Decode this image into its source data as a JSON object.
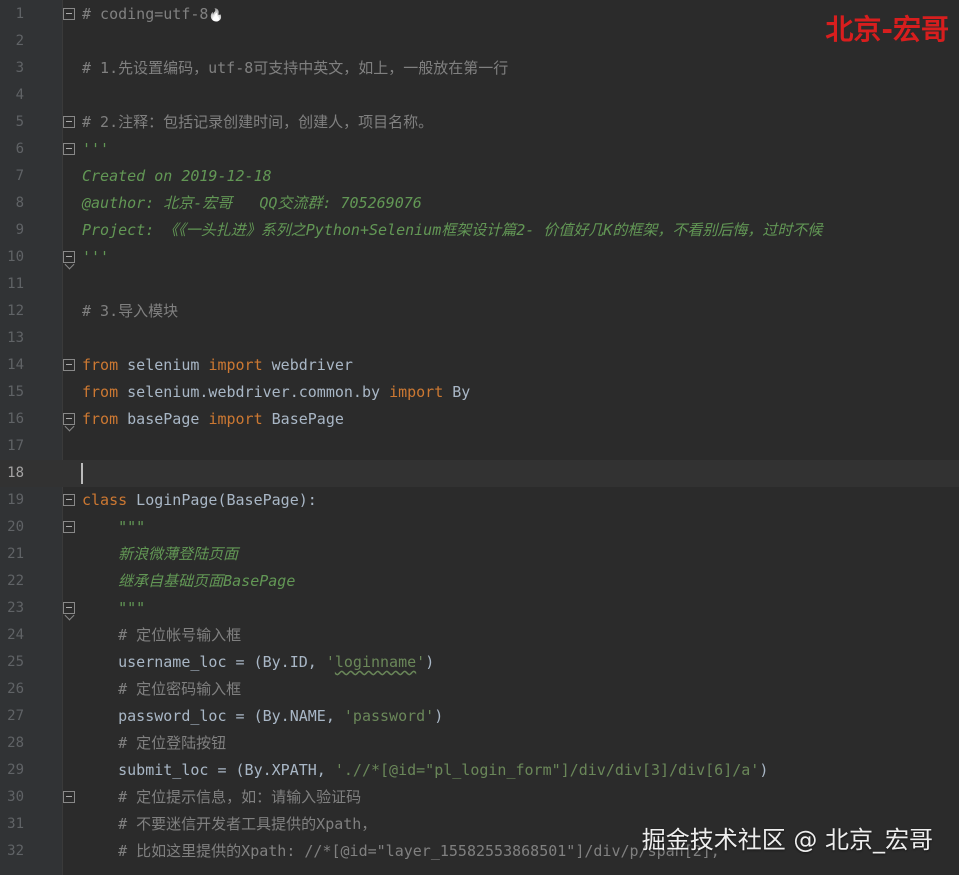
{
  "editor": {
    "lines": [
      {
        "n": "1",
        "tokens": [
          {
            "t": "# coding=utf-8",
            "c": "comment"
          },
          {
            "t": "",
            "c": "fire"
          }
        ],
        "fold": "start"
      },
      {
        "n": "2",
        "tokens": []
      },
      {
        "n": "3",
        "tokens": [
          {
            "t": "# 1.先设置编码，utf-8可支持中英文，如上，一般放在第一行",
            "c": "comment"
          }
        ]
      },
      {
        "n": "4",
        "tokens": []
      },
      {
        "n": "5",
        "tokens": [
          {
            "t": "# 2.注释：包括记录创建时间，创建人，项目名称。",
            "c": "comment"
          }
        ],
        "fold": "start"
      },
      {
        "n": "6",
        "tokens": [
          {
            "t": "'''",
            "c": "doc"
          }
        ],
        "fold": "start"
      },
      {
        "n": "7",
        "tokens": [
          {
            "t": "Created on 2019-12-18",
            "c": "doc"
          }
        ]
      },
      {
        "n": "8",
        "tokens": [
          {
            "t": "@author: 北京-宏哥   QQ交流群: 705269076",
            "c": "doc"
          }
        ]
      },
      {
        "n": "9",
        "tokens": [
          {
            "t": "Project: 《《一头扎进》系列之Python+Selenium框架设计篇2- 价值好几K的框架，不看别后悔，过时不候",
            "c": "doc"
          }
        ]
      },
      {
        "n": "10",
        "tokens": [
          {
            "t": "'''",
            "c": "doc"
          }
        ],
        "fold": "end"
      },
      {
        "n": "11",
        "tokens": []
      },
      {
        "n": "12",
        "tokens": [
          {
            "t": "# 3.导入模块",
            "c": "comment"
          }
        ]
      },
      {
        "n": "13",
        "tokens": []
      },
      {
        "n": "14",
        "tokens": [
          {
            "t": "from",
            "c": "kw"
          },
          {
            "t": " selenium ",
            "c": "plain"
          },
          {
            "t": "import",
            "c": "kw"
          },
          {
            "t": " webdriver",
            "c": "plain"
          }
        ],
        "fold": "start"
      },
      {
        "n": "15",
        "tokens": [
          {
            "t": "from",
            "c": "kw"
          },
          {
            "t": " selenium.webdriver.common.by ",
            "c": "plain"
          },
          {
            "t": "import",
            "c": "kw"
          },
          {
            "t": " By",
            "c": "plain"
          }
        ]
      },
      {
        "n": "16",
        "tokens": [
          {
            "t": "from",
            "c": "kw"
          },
          {
            "t": " basePage ",
            "c": "plain"
          },
          {
            "t": "import",
            "c": "kw"
          },
          {
            "t": " BasePage",
            "c": "plain"
          }
        ],
        "fold": "end"
      },
      {
        "n": "17",
        "tokens": []
      },
      {
        "n": "18",
        "tokens": [],
        "current": true
      },
      {
        "n": "19",
        "tokens": [
          {
            "t": "class",
            "c": "kw"
          },
          {
            "t": " LoginPage(BasePage):",
            "c": "plain"
          }
        ],
        "fold": "start"
      },
      {
        "n": "20",
        "tokens": [
          {
            "t": "    \"\"\"",
            "c": "doc"
          }
        ],
        "fold": "start"
      },
      {
        "n": "21",
        "tokens": [
          {
            "t": "    新浪微薄登陆页面",
            "c": "doc"
          }
        ]
      },
      {
        "n": "22",
        "tokens": [
          {
            "t": "    继承自基础页面BasePage",
            "c": "doc"
          }
        ]
      },
      {
        "n": "23",
        "tokens": [
          {
            "t": "    \"\"\"",
            "c": "doc"
          }
        ],
        "fold": "end"
      },
      {
        "n": "24",
        "tokens": [
          {
            "t": "    # 定位帐号输入框",
            "c": "comment"
          }
        ]
      },
      {
        "n": "25",
        "tokens": [
          {
            "t": "    username_loc = (By.ID, ",
            "c": "plain"
          },
          {
            "t": "'",
            "c": "str"
          },
          {
            "t": "loginname",
            "c": "str squig"
          },
          {
            "t": "'",
            "c": "str"
          },
          {
            "t": ")",
            "c": "plain"
          }
        ]
      },
      {
        "n": "26",
        "tokens": [
          {
            "t": "    # 定位密码输入框",
            "c": "comment"
          }
        ]
      },
      {
        "n": "27",
        "tokens": [
          {
            "t": "    password_loc = (By.NAME, ",
            "c": "plain"
          },
          {
            "t": "'password'",
            "c": "str"
          },
          {
            "t": ")",
            "c": "plain"
          }
        ]
      },
      {
        "n": "28",
        "tokens": [
          {
            "t": "    # 定位登陆按钮",
            "c": "comment"
          }
        ]
      },
      {
        "n": "29",
        "tokens": [
          {
            "t": "    submit_loc = (By.XPATH, ",
            "c": "plain"
          },
          {
            "t": "'.//*[@id=\"pl_login_form\"]/div/div[3]/div[6]/a'",
            "c": "str"
          },
          {
            "t": ")",
            "c": "plain"
          }
        ]
      },
      {
        "n": "30",
        "tokens": [
          {
            "t": "    # 定位提示信息，如：请输入验证码",
            "c": "comment"
          }
        ],
        "fold": "start"
      },
      {
        "n": "31",
        "tokens": [
          {
            "t": "    # 不要迷信开发者工具提供的Xpath，",
            "c": "comment"
          }
        ]
      },
      {
        "n": "32",
        "tokens": [
          {
            "t": "    # 比如这里提供的Xpath: //*[@id=\"layer_15582553868501\"]/div/p/span[2],",
            "c": "comment"
          }
        ]
      }
    ]
  },
  "watermarks": {
    "top": "北京-宏哥",
    "bottom": "掘金技术社区 @ 北京_宏哥"
  },
  "colors": {
    "background": "#2b2b2b",
    "keyword": "#cc7832",
    "comment": "#808080",
    "docstring": "#629755",
    "string": "#6a8759",
    "watermark_red": "#d81e1e"
  }
}
